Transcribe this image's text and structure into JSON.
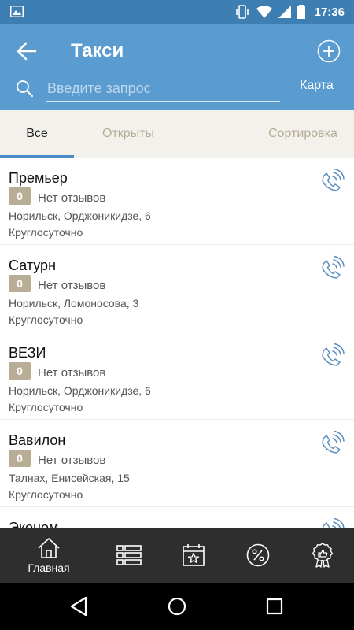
{
  "status_bar": {
    "time": "17:36"
  },
  "header": {
    "title": "Такси",
    "search_placeholder": "Введите запрос",
    "map_label": "Карта"
  },
  "tabs": [
    {
      "label": "Все",
      "active": true
    },
    {
      "label": "Открыты",
      "active": false
    },
    {
      "label": "Сортировка",
      "active": false
    }
  ],
  "list": {
    "items": [
      {
        "name": "Премьер",
        "rating": "0",
        "reviews": "Нет отзывов",
        "address": "Норильск, Орджоникидзе, 6",
        "hours": "Круглосуточно"
      },
      {
        "name": "Сатурн",
        "rating": "0",
        "reviews": "Нет отзывов",
        "address": "Норильск, Ломоносова, 3",
        "hours": "Круглосуточно"
      },
      {
        "name": "ВЕЗИ",
        "rating": "0",
        "reviews": "Нет отзывов",
        "address": "Норильск, Орджоникидзе, 6",
        "hours": "Круглосуточно"
      },
      {
        "name": "Вавилон",
        "rating": "0",
        "reviews": "Нет отзывов",
        "address": "Талнах, Енисейская, 15",
        "hours": "Круглосуточно"
      },
      {
        "name": "Эконом",
        "rating": "",
        "reviews": "",
        "address": "",
        "hours": ""
      }
    ]
  },
  "bottom_nav": {
    "items": [
      {
        "label": "Главная",
        "icon": "home-icon"
      },
      {
        "label": "",
        "icon": "list-icon"
      },
      {
        "label": "",
        "icon": "calendar-star-icon"
      },
      {
        "label": "",
        "icon": "percent-icon"
      },
      {
        "label": "",
        "icon": "award-icon"
      }
    ]
  },
  "colors": {
    "status_bar": "#3d7fb3",
    "app_bar": "#5a9bd0",
    "tab_bg": "#f3f1ec",
    "tab_inactive": "#b5ab94",
    "tab_indicator": "#4a8dc8",
    "badge": "#b8ad95",
    "icon_blue": "#5a8fbf",
    "bottom_nav": "#2e2e2e"
  }
}
